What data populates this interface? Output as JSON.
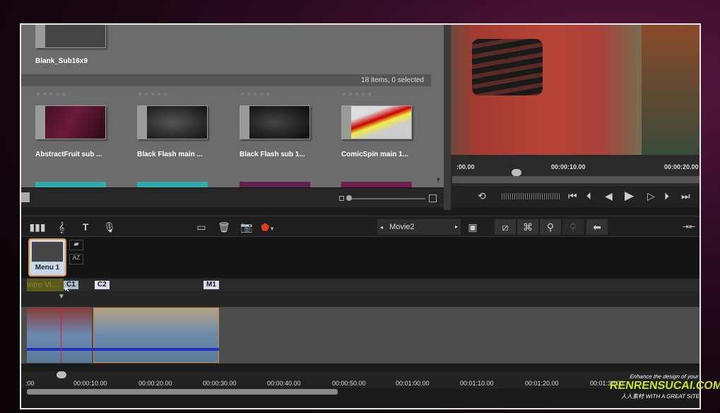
{
  "library": {
    "top_item": "Blank_Sub16x9",
    "status": "18 items, 0 selected",
    "items": [
      {
        "label": "AbstractFruit sub ...",
        "rating": "★★★★★"
      },
      {
        "label": "Black Flash main ...",
        "rating": "★★★★★"
      },
      {
        "label": "Black Flash sub 1...",
        "rating": "★★★★★"
      },
      {
        "label": "ComicSpin main 1...",
        "rating": "★★★★★"
      }
    ]
  },
  "preview": {
    "ruler": [
      ":00.00",
      "00:00:10.00",
      "00:00:20.00"
    ],
    "controls": [
      "loop-icon",
      "jog-wheel",
      "go-start-icon",
      "prev-frame-icon",
      "step-back-icon",
      "play-icon",
      "step-forward-icon",
      "next-frame-icon",
      "go-end-icon"
    ]
  },
  "toolbar": {
    "tools": [
      "audio-mixer-icon",
      "music-icon",
      "title-icon",
      "microphone-icon"
    ],
    "edit": [
      "razor-icon",
      "trash-icon",
      "snapshot-icon",
      "marker-icon"
    ],
    "project": "Movie2",
    "nav_left": "◂",
    "nav_right": "▸"
  },
  "menu": {
    "label": "Menu 1",
    "sort_label": "AZ"
  },
  "chapters": {
    "intro": "Intro Vi...",
    "markers": [
      "C1",
      "C2",
      "M1"
    ]
  },
  "timeline": {
    "ruler": [
      ":00",
      "00:00:10.00",
      "00:00:20.00",
      "00:00:30.00",
      "00:00:40.00",
      "00:00:50.00",
      "00:01:00.00",
      "00:01:10.00",
      "00:01:20.00",
      "00:01:30.00"
    ]
  },
  "watermark": {
    "line1": "Enhance the design of your",
    "line2": "RENRENSUCAI.COM",
    "line3": "人人素材 WITH A GREAT SITE!"
  }
}
